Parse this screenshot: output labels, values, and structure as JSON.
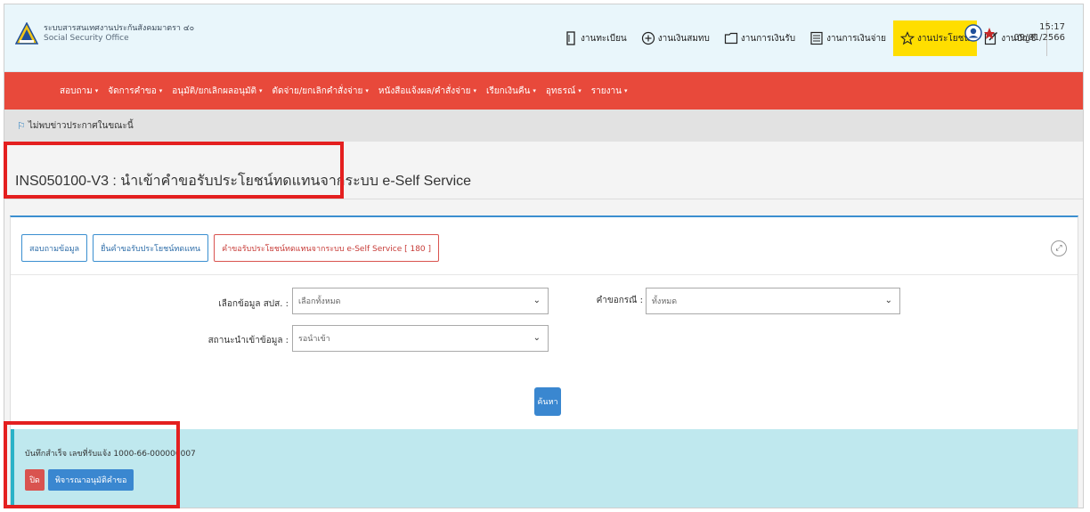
{
  "header": {
    "org_name": "ระบบสารสนเทศงานประกันสังคมมาตรา ๔๐",
    "org_sub": "Social Security Office",
    "nav": [
      {
        "label": "งานทะเบียน",
        "icon": "register-icon",
        "active": false
      },
      {
        "label": "งานเงินสมทบ",
        "icon": "plus-circle-icon",
        "active": false
      },
      {
        "label": "งานการเงินรับ",
        "icon": "folder-icon",
        "active": false
      },
      {
        "label": "งานการเงินจ่าย",
        "icon": "calculator-icon",
        "active": false
      },
      {
        "label": "งานประโยชน์",
        "icon": "star-icon",
        "active": true
      },
      {
        "label": "งานบัญชี",
        "icon": "edit-icon",
        "active": false
      }
    ],
    "time": "15:17",
    "date": "09/01/2566"
  },
  "menu": [
    "สอบถาม",
    "จัดการคำขอ",
    "อนุมัติ/ยกเลิกผลอนุมัติ",
    "ตัดจ่าย/ยกเลิกคำสั่งจ่าย",
    "หนังสือแจ้งผล/คำสั่งจ่าย",
    "เรียกเงินคืน",
    "อุทธรณ์",
    "รายงาน"
  ],
  "announcement": "ไม่พบข่าวประกาศในขณะนี้",
  "page_title": "INS050100-V3 : นำเข้าคำขอรับประโยชน์ทดแทนจากระบบ e-Self Service",
  "tabs": [
    "สอบถามข้อมูล",
    "ยื่นคำขอรับประโยชน์ทดแทน",
    "คำขอรับประโยชน์ทดแทนจากระบบ e-Self Service [ 180 ]"
  ],
  "form": {
    "office_label": "เลือกข้อมูล สปส. :",
    "office_value": "เลือกทั้งหมด",
    "case_label": "คำขอกรณี :",
    "case_value": "ทั้งหมด",
    "status_label": "สถานะนำเข้าข้อมูล :",
    "status_value": "รอนำเข้า",
    "search_label": "ค้นหา"
  },
  "alert": {
    "message": "บันทึกสำเร็จ เลขที่รับแจ้ง 1000-66-000000007",
    "close_label": "ปิด",
    "consider_label": "พิจารณาอนุมัติคำขอ"
  },
  "colors": {
    "menu_red": "#e8493b",
    "active_nav": "#ffde00",
    "primary_blue": "#3a87d0",
    "alert_bg": "#bfe8ee",
    "highlight_red": "#e41f1f"
  }
}
